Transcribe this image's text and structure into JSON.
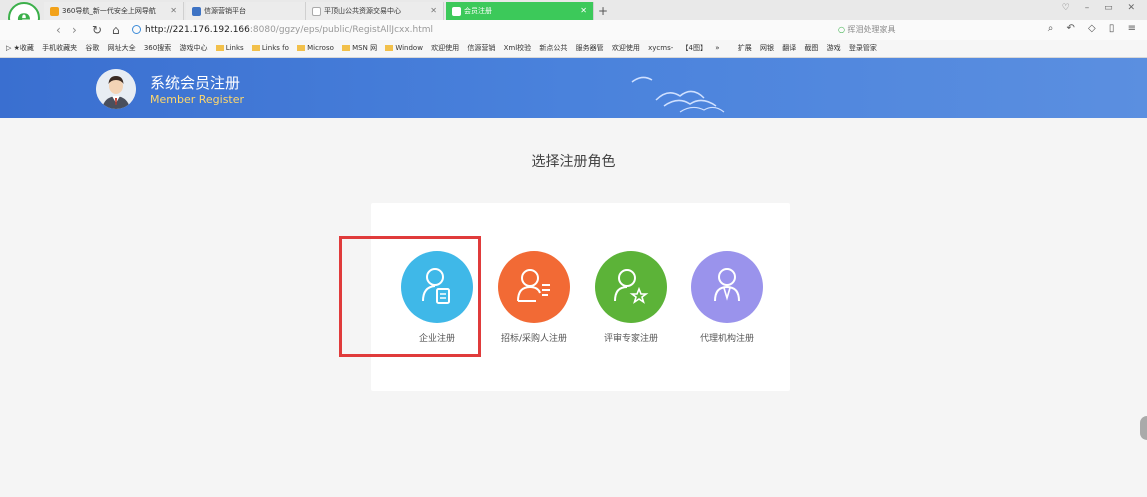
{
  "browser": {
    "tabs": [
      {
        "label": "360导航_新一代安全上网导航",
        "active": false
      },
      {
        "label": "信源营销平台",
        "active": false
      },
      {
        "label": "平顶山公共资源交易中心",
        "active": false
      },
      {
        "label": "会员注册",
        "active": true
      }
    ],
    "new_tab": "+",
    "url_host": "http://221.176.192.166",
    "url_rest": ":8080/ggzy/eps/public/RegistAllJcxx.html",
    "search_placeholder": "挥泪处理家具",
    "bookmarks": [
      "收藏",
      "手机收藏夹",
      "谷歌",
      "网址大全",
      "360搜索",
      "游戏中心",
      "Links",
      "Links fo",
      "Microso",
      "MSN 网",
      "Window",
      "欢迎使用",
      "信源营销",
      "Xml校验",
      "新点公共",
      "服务器管",
      "欢迎使用",
      "xycms-",
      "【4图】",
      "»"
    ],
    "bookmarks_right": [
      "扩展",
      "网银",
      "翻译",
      "截图",
      "游戏",
      "登录管家"
    ]
  },
  "header": {
    "title": "系统会员注册",
    "subtitle": "Member Register"
  },
  "main": {
    "title": "选择注册角色",
    "roles": [
      {
        "label": "企业注册",
        "color": "#3fb8e8",
        "icon": "user-document-icon"
      },
      {
        "label": "招标/采购人注册",
        "color": "#f26a35",
        "icon": "user-list-icon"
      },
      {
        "label": "评审专家注册",
        "color": "#5cb338",
        "icon": "user-star-icon"
      },
      {
        "label": "代理机构注册",
        "color": "#9a93ec",
        "icon": "user-tie-icon"
      }
    ]
  },
  "colors": {
    "header_blue": "#4a82dc",
    "highlight_red": "#e03b3b"
  }
}
